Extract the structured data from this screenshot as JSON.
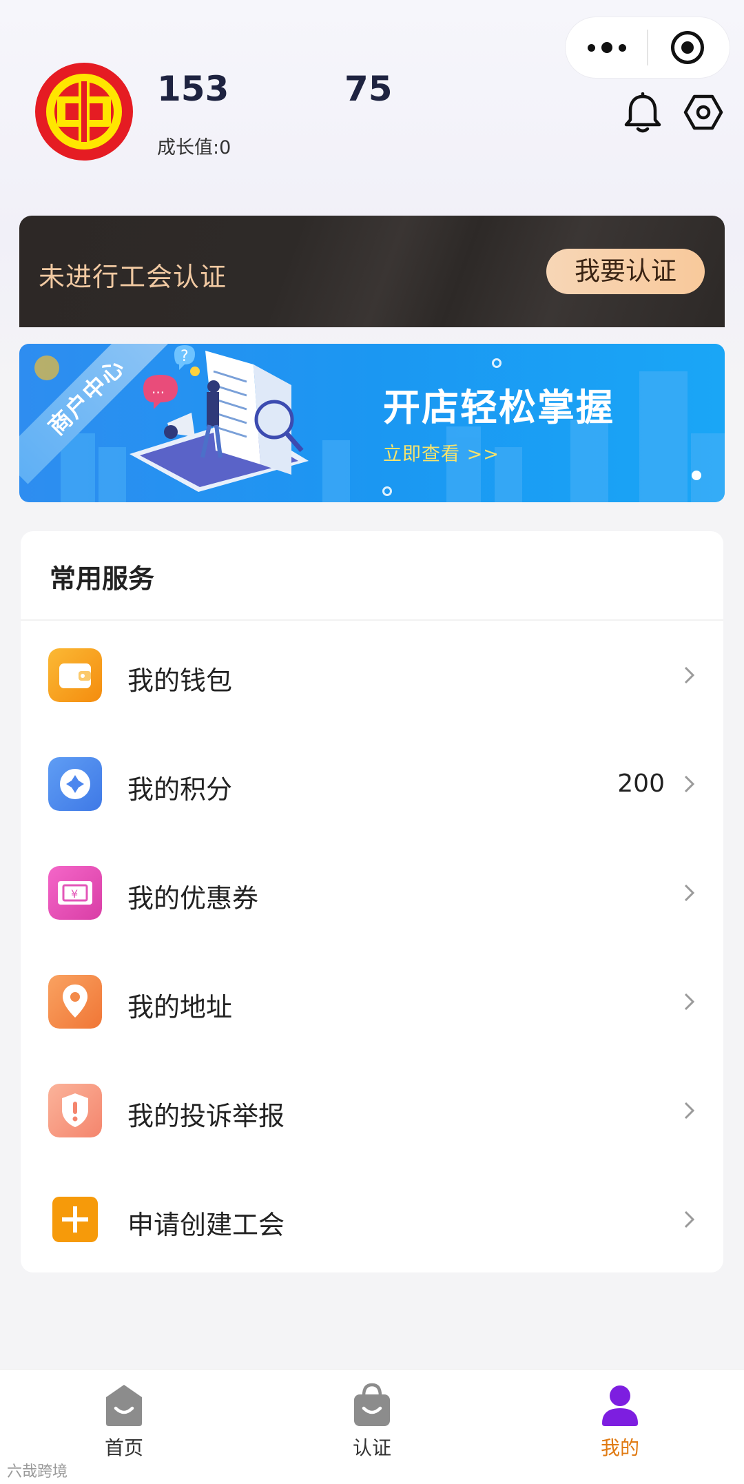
{
  "profile": {
    "stat_1": "153",
    "stat_2": "75",
    "growth": "成长值:0"
  },
  "certification": {
    "status_text": "未进行工会认证",
    "button_label": "我要认证"
  },
  "promo": {
    "ribbon": "商户中心",
    "title": "开店轻松掌握",
    "link": "立即查看 >>"
  },
  "services": {
    "title": "常用服务",
    "items": [
      {
        "label": "我的钱包",
        "value": "",
        "icon": "wallet-icon",
        "color": "#f7a21b"
      },
      {
        "label": "我的积分",
        "value": "200",
        "icon": "points-icon",
        "color": "#4f8ff0"
      },
      {
        "label": "我的优惠券",
        "value": "",
        "icon": "coupon-icon",
        "color": "#e850b6"
      },
      {
        "label": "我的地址",
        "value": "",
        "icon": "location-pin-icon",
        "color": "#f58a4a"
      },
      {
        "label": "我的投诉举报",
        "value": "",
        "icon": "shield-alert-icon",
        "color": "#f59a82"
      },
      {
        "label": "申请创建工会",
        "value": "",
        "icon": "plus-icon",
        "color": "#f69a0a"
      }
    ]
  },
  "tabbar": {
    "items": [
      {
        "label": "首页",
        "active": false
      },
      {
        "label": "认证",
        "active": false
      },
      {
        "label": "我的",
        "active": true
      }
    ]
  },
  "watermark": "六哉跨境",
  "colors": {
    "accent": "#e07a12",
    "active_tab_icon": "#7d1ee0",
    "cert_bg": "#2d2826",
    "cert_text": "#f1c9a2",
    "promo_bg": "#1b97f2"
  }
}
